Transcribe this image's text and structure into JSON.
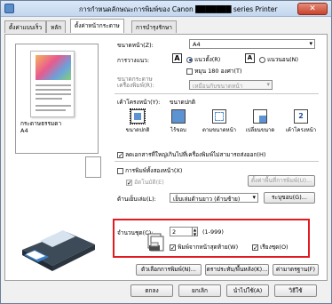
{
  "window": {
    "title": "การกำหนดลักษณะการพิมพ์ของ Canon ███████ series Printer",
    "close_glyph": "✕"
  },
  "tabs": [
    {
      "label": "ตั้งค่าแบบเร็ว"
    },
    {
      "label": "หลัก"
    },
    {
      "label": "ตั้งค่าหน้ากระดาษ"
    },
    {
      "label": "การบำรุงรักษา"
    }
  ],
  "preview": {
    "media_label": "กระดาษธรรมดา",
    "size_label": "A4"
  },
  "page_size": {
    "label": "ขนาดหน้า(Z):",
    "value": "A4"
  },
  "orientation": {
    "label": "การวางแนว:",
    "portrait_label": "แนวตั้ง(R)",
    "landscape_label": "แนวนอน(N)",
    "selected": "portrait",
    "rotate_label": "หมุน 180 องศา(T)",
    "rotate_checked": false
  },
  "printer_paper": {
    "label": "ขนาดกระดาษเครื่องพิมพ์(R):",
    "value": "เหมือนกับขนาดหน้า"
  },
  "layout": {
    "label": "เค้าโครงหน้า(Y):",
    "value_label": "ขนาดปกติ",
    "options": [
      {
        "label": "ขนาดปกติ",
        "selected": true
      },
      {
        "label": "ไร้ขอบ",
        "selected": false
      },
      {
        "label": "ตามขนาดหน้า",
        "selected": false
      },
      {
        "label": "เปลี่ยนขนาด",
        "selected": false
      },
      {
        "label": "เค้าโครงหน้า",
        "selected": false,
        "badge": "2"
      }
    ]
  },
  "auto_reduce": {
    "label": "ลดเอกสารที่ใหญ่เกินไปที่เครื่องพิมพ์ไม่สามารถส่งออก(H)",
    "checked": true
  },
  "duplex": {
    "label": "การพิมพ์ทั้งสองหน้า(X)",
    "checked": false,
    "auto_label": "อัตโนมัติ(E)",
    "margin_button": "ตั้งค่าพื้นที่การพิมพ์(U)..."
  },
  "stapling": {
    "label": "ด้านเย็บเล่ม(L):",
    "value": "เย็บเล่มด้านยาว (ด้านซ้าย)",
    "margin_button": "ระบุขอบ(G)..."
  },
  "copies": {
    "label": "จำนวนชุด(C):",
    "value": "2",
    "range": "(1-999)",
    "last_page_label": "พิมพ์จากหน้าสุดท้าย(W)",
    "last_page_checked": true,
    "collate_label": "เรียงชุด(O)",
    "collate_checked": true
  },
  "options_buttons": {
    "printer_options": "ตัวเลือกการพิมพ์(N)...",
    "stamp": "ตราประทับ/พื้นหลัง(K)...",
    "defaults": "ค่ามาตรฐาน(F)"
  },
  "dialog_buttons": {
    "ok": "ตกลง",
    "cancel": "ยกเลิก",
    "apply": "นำไปใช้(A)",
    "help": "วิธีใช้"
  },
  "colors": {
    "highlight_border": "#e21b23",
    "title_gradient": "#dbe8f7"
  }
}
